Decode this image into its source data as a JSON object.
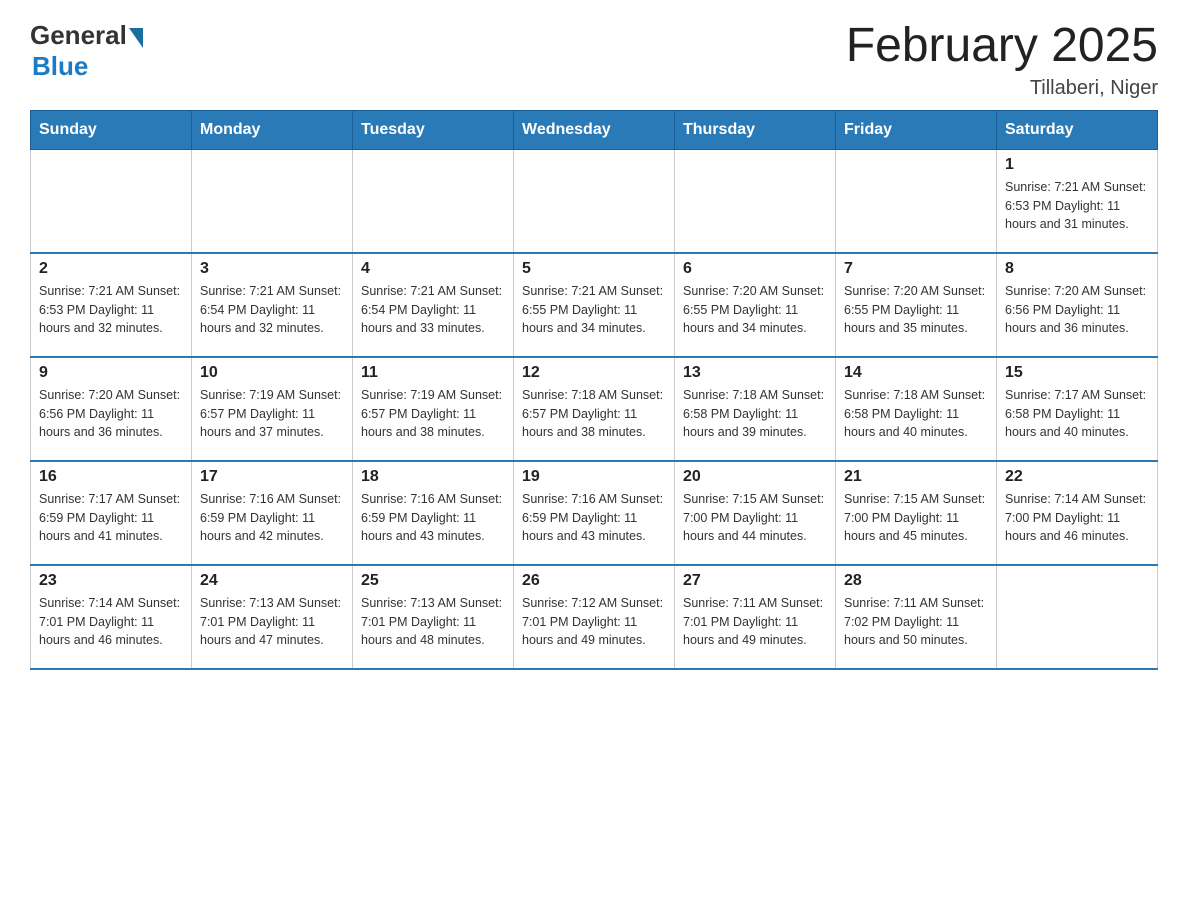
{
  "header": {
    "logo_general": "General",
    "logo_blue": "Blue",
    "month_title": "February 2025",
    "location": "Tillaberi, Niger"
  },
  "days_of_week": [
    "Sunday",
    "Monday",
    "Tuesday",
    "Wednesday",
    "Thursday",
    "Friday",
    "Saturday"
  ],
  "weeks": [
    [
      {
        "day": "",
        "info": ""
      },
      {
        "day": "",
        "info": ""
      },
      {
        "day": "",
        "info": ""
      },
      {
        "day": "",
        "info": ""
      },
      {
        "day": "",
        "info": ""
      },
      {
        "day": "",
        "info": ""
      },
      {
        "day": "1",
        "info": "Sunrise: 7:21 AM\nSunset: 6:53 PM\nDaylight: 11 hours\nand 31 minutes."
      }
    ],
    [
      {
        "day": "2",
        "info": "Sunrise: 7:21 AM\nSunset: 6:53 PM\nDaylight: 11 hours\nand 32 minutes."
      },
      {
        "day": "3",
        "info": "Sunrise: 7:21 AM\nSunset: 6:54 PM\nDaylight: 11 hours\nand 32 minutes."
      },
      {
        "day": "4",
        "info": "Sunrise: 7:21 AM\nSunset: 6:54 PM\nDaylight: 11 hours\nand 33 minutes."
      },
      {
        "day": "5",
        "info": "Sunrise: 7:21 AM\nSunset: 6:55 PM\nDaylight: 11 hours\nand 34 minutes."
      },
      {
        "day": "6",
        "info": "Sunrise: 7:20 AM\nSunset: 6:55 PM\nDaylight: 11 hours\nand 34 minutes."
      },
      {
        "day": "7",
        "info": "Sunrise: 7:20 AM\nSunset: 6:55 PM\nDaylight: 11 hours\nand 35 minutes."
      },
      {
        "day": "8",
        "info": "Sunrise: 7:20 AM\nSunset: 6:56 PM\nDaylight: 11 hours\nand 36 minutes."
      }
    ],
    [
      {
        "day": "9",
        "info": "Sunrise: 7:20 AM\nSunset: 6:56 PM\nDaylight: 11 hours\nand 36 minutes."
      },
      {
        "day": "10",
        "info": "Sunrise: 7:19 AM\nSunset: 6:57 PM\nDaylight: 11 hours\nand 37 minutes."
      },
      {
        "day": "11",
        "info": "Sunrise: 7:19 AM\nSunset: 6:57 PM\nDaylight: 11 hours\nand 38 minutes."
      },
      {
        "day": "12",
        "info": "Sunrise: 7:18 AM\nSunset: 6:57 PM\nDaylight: 11 hours\nand 38 minutes."
      },
      {
        "day": "13",
        "info": "Sunrise: 7:18 AM\nSunset: 6:58 PM\nDaylight: 11 hours\nand 39 minutes."
      },
      {
        "day": "14",
        "info": "Sunrise: 7:18 AM\nSunset: 6:58 PM\nDaylight: 11 hours\nand 40 minutes."
      },
      {
        "day": "15",
        "info": "Sunrise: 7:17 AM\nSunset: 6:58 PM\nDaylight: 11 hours\nand 40 minutes."
      }
    ],
    [
      {
        "day": "16",
        "info": "Sunrise: 7:17 AM\nSunset: 6:59 PM\nDaylight: 11 hours\nand 41 minutes."
      },
      {
        "day": "17",
        "info": "Sunrise: 7:16 AM\nSunset: 6:59 PM\nDaylight: 11 hours\nand 42 minutes."
      },
      {
        "day": "18",
        "info": "Sunrise: 7:16 AM\nSunset: 6:59 PM\nDaylight: 11 hours\nand 43 minutes."
      },
      {
        "day": "19",
        "info": "Sunrise: 7:16 AM\nSunset: 6:59 PM\nDaylight: 11 hours\nand 43 minutes."
      },
      {
        "day": "20",
        "info": "Sunrise: 7:15 AM\nSunset: 7:00 PM\nDaylight: 11 hours\nand 44 minutes."
      },
      {
        "day": "21",
        "info": "Sunrise: 7:15 AM\nSunset: 7:00 PM\nDaylight: 11 hours\nand 45 minutes."
      },
      {
        "day": "22",
        "info": "Sunrise: 7:14 AM\nSunset: 7:00 PM\nDaylight: 11 hours\nand 46 minutes."
      }
    ],
    [
      {
        "day": "23",
        "info": "Sunrise: 7:14 AM\nSunset: 7:01 PM\nDaylight: 11 hours\nand 46 minutes."
      },
      {
        "day": "24",
        "info": "Sunrise: 7:13 AM\nSunset: 7:01 PM\nDaylight: 11 hours\nand 47 minutes."
      },
      {
        "day": "25",
        "info": "Sunrise: 7:13 AM\nSunset: 7:01 PM\nDaylight: 11 hours\nand 48 minutes."
      },
      {
        "day": "26",
        "info": "Sunrise: 7:12 AM\nSunset: 7:01 PM\nDaylight: 11 hours\nand 49 minutes."
      },
      {
        "day": "27",
        "info": "Sunrise: 7:11 AM\nSunset: 7:01 PM\nDaylight: 11 hours\nand 49 minutes."
      },
      {
        "day": "28",
        "info": "Sunrise: 7:11 AM\nSunset: 7:02 PM\nDaylight: 11 hours\nand 50 minutes."
      },
      {
        "day": "",
        "info": ""
      }
    ]
  ]
}
